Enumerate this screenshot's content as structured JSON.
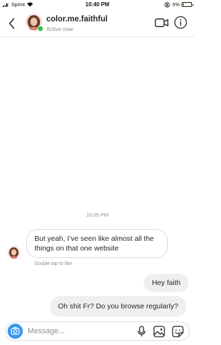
{
  "status_bar": {
    "carrier": "Sprint",
    "time": "10:40 PM",
    "battery_percent": "3%",
    "battery_level": 0.03,
    "battery_color": "#111111"
  },
  "header": {
    "username": "color.me.faithful",
    "status": "Active now",
    "icons": [
      "back-chevron-icon",
      "video-camera-icon",
      "info-icon"
    ],
    "online_color": "#2fbf4b"
  },
  "conversation": {
    "timestamp": "10:05 PM",
    "messages": [
      {
        "direction": "incoming",
        "text": "But yeah, I’ve seen like almost all the things on that one website"
      },
      {
        "direction": "outgoing",
        "text": "Hey faith"
      },
      {
        "direction": "outgoing",
        "text": "Oh shit Fr? Do you browse regularly?"
      }
    ],
    "hint": "Double tap to like"
  },
  "composer": {
    "placeholder": "Message...",
    "icons": [
      "camera-icon",
      "microphone-icon",
      "gallery-icon",
      "sticker-icon"
    ],
    "accent_color": "#3897f0"
  }
}
